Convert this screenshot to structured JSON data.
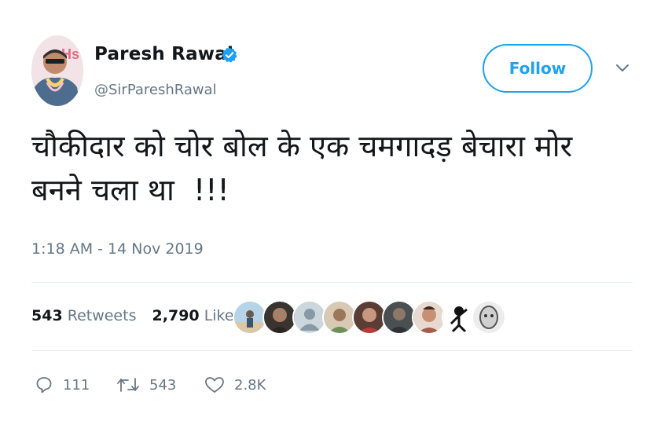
{
  "author": {
    "name": "Paresh Rawal",
    "handle": "@SirPareshRawal",
    "verified": true,
    "avatar_icon": "profile-photo"
  },
  "follow_button": {
    "label": "Follow"
  },
  "menu": {
    "icon": "chevron-down-icon"
  },
  "tweet": {
    "text_line1": "चौकीदार को चोर बोल के एक चमगादड़ बेचारा मोर",
    "text_line2": "बनने चला था  !!!",
    "timestamp": "1:18 AM - 14 Nov 2019"
  },
  "stats": {
    "retweets_count": "543",
    "retweets_label": "Retweets",
    "likes_count": "2,790",
    "likes_label": "Likes",
    "liker_count": 9
  },
  "actions": {
    "reply_count": "111",
    "retweet_count": "543",
    "like_count": "2.8K"
  },
  "colors": {
    "accent": "#1da1f2",
    "secondary_text": "#657786",
    "divider": "#e6ecf0"
  }
}
